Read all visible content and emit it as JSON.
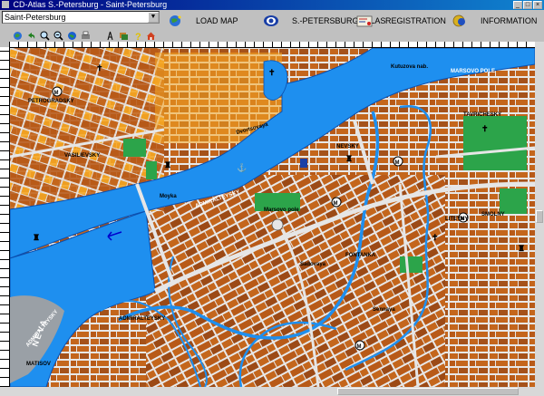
{
  "window": {
    "title": "CD-Atlas S.-Petersburg - Saint-Petersburg",
    "minimize": "_",
    "maximize": "□",
    "close": "×"
  },
  "menubar": {
    "city_select_value": "Saint-Petersburg",
    "items": [
      {
        "label": "LOAD MAP",
        "icon": "globe-icon"
      },
      {
        "label": "S.-PETERSBURG ATLAS",
        "icon": "eye-icon"
      },
      {
        "label": "REGISTRATION",
        "icon": "certificate-icon"
      },
      {
        "label": "INFORMATION",
        "icon": "coin-icon"
      }
    ]
  },
  "toolbar": {
    "icons": [
      "globe-tool-icon",
      "back-arrow-icon",
      "zoom-in-icon",
      "zoom-out-icon",
      "world-icon",
      "print-icon",
      "compass-icon",
      "layers-icon",
      "help-icon",
      "home-icon"
    ]
  },
  "map": {
    "labels": {
      "neva": "NEVA",
      "admiralteysky": "ADMIRALTEYSKY",
      "bolshaya_neva": "ADMIRALTEYSKY",
      "liteyny": "LITEYNY",
      "dvortsovaya": "Dvortsovaya",
      "smolny": "SMOLNY",
      "tavrichesky": "TAVRICHESKY",
      "sadovaya": "Sadovaya",
      "nevsky": "NEVSKY",
      "fontanka": "FONTANKA",
      "moyka": "Moyka",
      "kutuzov": "Kutuzova nab.",
      "mars_field": "Marsovo pole",
      "sennaya": "Sennaya",
      "vasilievsky": "VASILIEVSKY",
      "petrogradsky": "PETROGRADSKY",
      "marsovo_pole": "MARSOVO POLE",
      "admiralteysky_rayon": "ADMIRALTEYSKY",
      "mariinsky": "MATISOV"
    },
    "colors": {
      "water": "#1e8fef",
      "blocks": "#c4661c",
      "blocks_light": "#f5a623",
      "parks": "#2ca44a",
      "streets": "#e6e6e6",
      "road_major": "#b8b8b8"
    }
  }
}
